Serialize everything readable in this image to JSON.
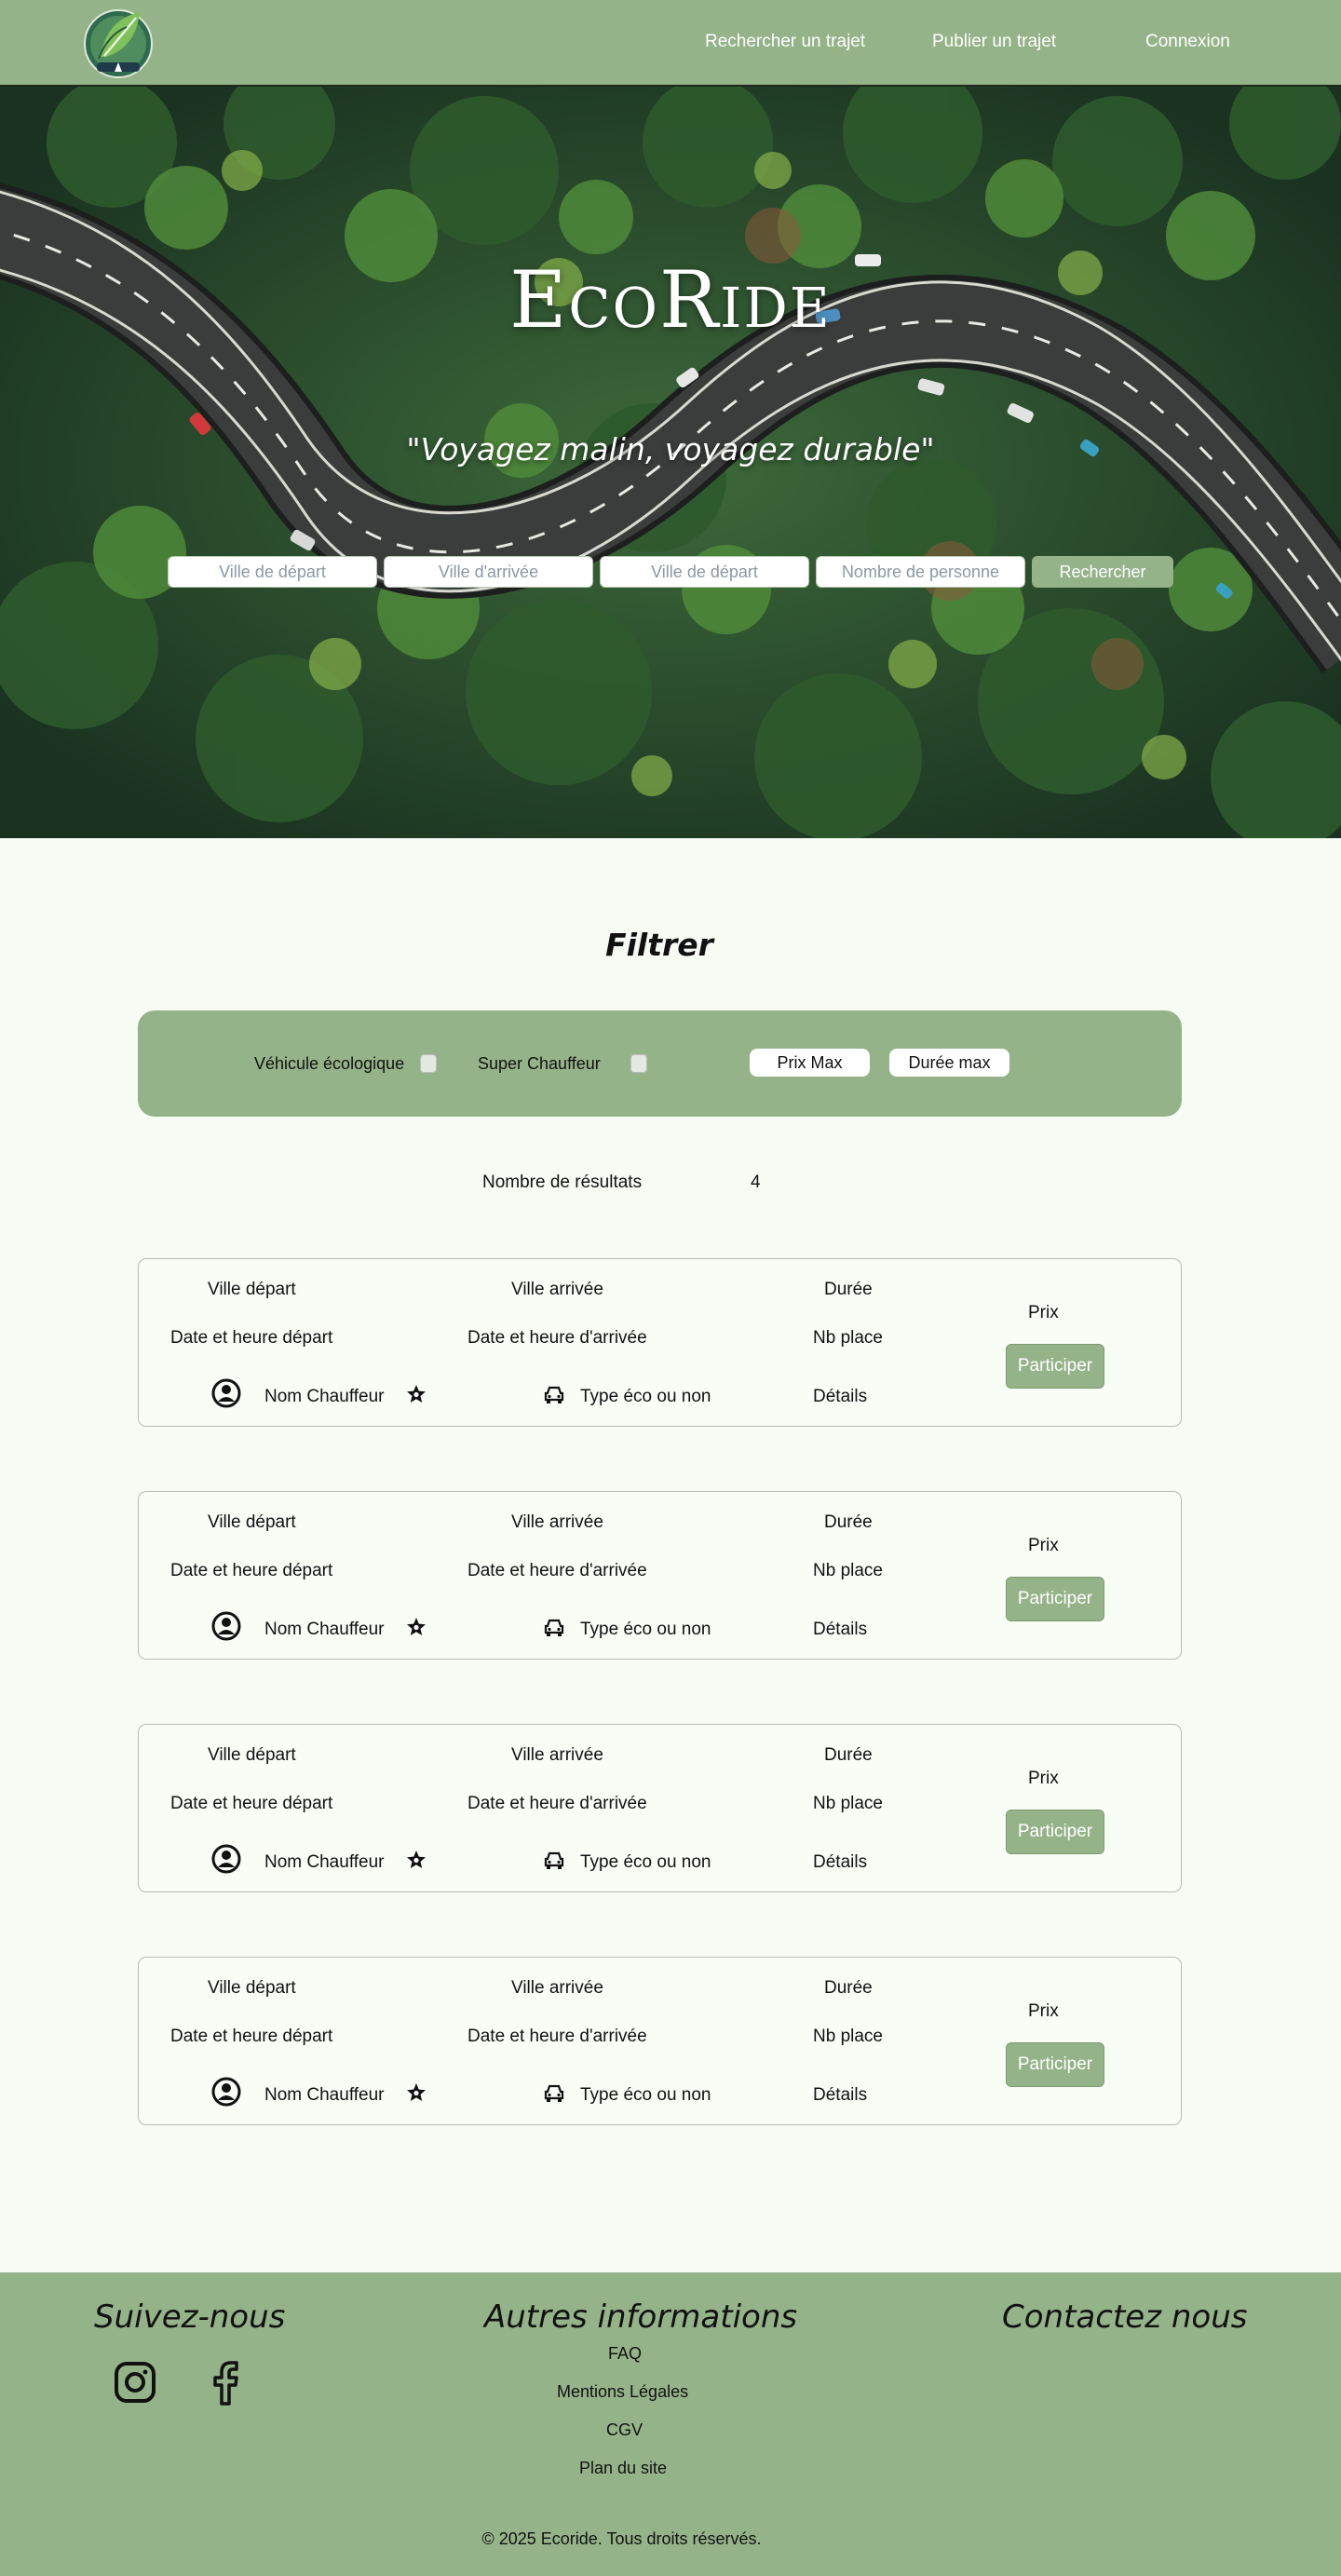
{
  "nav": {
    "links": [
      "Rechercher un trajet",
      "Publier un trajet",
      "Connexion"
    ]
  },
  "hero": {
    "title": "EcoRide",
    "tagline": "\"Voyagez malin, voyagez durable\"",
    "search": {
      "placeholders": [
        "Ville de départ",
        "Ville d'arrivée",
        "Ville de départ",
        "Nombre de personne"
      ],
      "button": "Rechercher"
    }
  },
  "filter": {
    "title": "Filtrer",
    "eco_label": "Véhicule écologique",
    "super_label": "Super Chauffeur",
    "price_max": "Prix Max",
    "duration_max": "Durée max"
  },
  "results": {
    "label": "Nombre de résultats",
    "count": "4"
  },
  "cards": [
    {
      "departure_city": "Ville départ",
      "arrival_city": "Ville arrivée",
      "duration": "Durée",
      "departure_datetime": "Date et heure départ",
      "arrival_datetime": "Date et heure d'arrivée",
      "seats": "Nb place",
      "price": "Prix",
      "driver": "Nom Chauffeur",
      "vehicle": "Type éco ou non",
      "details": "Détails",
      "button": "Participer"
    },
    {
      "departure_city": "Ville départ",
      "arrival_city": "Ville arrivée",
      "duration": "Durée",
      "departure_datetime": "Date et heure départ",
      "arrival_datetime": "Date et heure d'arrivée",
      "seats": "Nb place",
      "price": "Prix",
      "driver": "Nom Chauffeur",
      "vehicle": "Type éco ou non",
      "details": "Détails",
      "button": "Participer"
    },
    {
      "departure_city": "Ville départ",
      "arrival_city": "Ville arrivée",
      "duration": "Durée",
      "departure_datetime": "Date et heure départ",
      "arrival_datetime": "Date et heure d'arrivée",
      "seats": "Nb place",
      "price": "Prix",
      "driver": "Nom Chauffeur",
      "vehicle": "Type éco ou non",
      "details": "Détails",
      "button": "Participer"
    },
    {
      "departure_city": "Ville départ",
      "arrival_city": "Ville arrivée",
      "duration": "Durée",
      "departure_datetime": "Date et heure départ",
      "arrival_datetime": "Date et heure d'arrivée",
      "seats": "Nb place",
      "price": "Prix",
      "driver": "Nom Chauffeur",
      "vehicle": "Type éco ou non",
      "details": "Détails",
      "button": "Participer"
    }
  ],
  "footer": {
    "follow_title": "Suivez-nous",
    "info_title": "Autres informations",
    "contact_title": "Contactez nous",
    "links": [
      "FAQ",
      "Mentions Légales",
      "CGV",
      "Plan du site"
    ],
    "copyright": "© 2025 Ecoride. Tous droits réservés."
  },
  "colors": {
    "accent_green": "#95b389",
    "page_background": "#f6fcf4",
    "text": "#111111"
  },
  "icons": [
    "leaf-logo-icon",
    "user-circle-icon",
    "star-icon",
    "car-icon",
    "instagram-icon",
    "facebook-icon"
  ]
}
